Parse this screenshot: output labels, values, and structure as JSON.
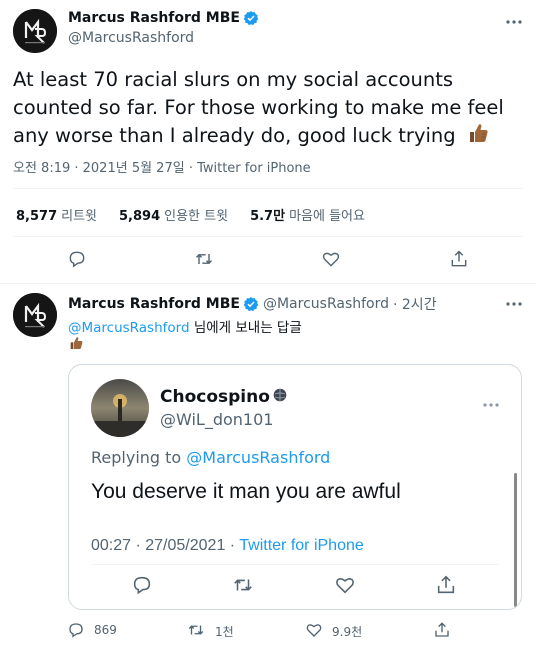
{
  "main_tweet": {
    "author": {
      "display_name": "Marcus Rashford MBE",
      "handle": "@MarcusRashford",
      "verified": true
    },
    "text": "At least 70 racial slurs on my social accounts counted so far. For those working to make me feel any worse than I already do, good luck trying",
    "emoji": "thumbs-up (medium-dark skin tone)",
    "timestamp": "오전 8:19 · 2021년 5월 27일 · Twitter for iPhone",
    "stats": {
      "retweets_value": "8,577",
      "retweets_label": "리트윗",
      "quotes_value": "5,894",
      "quotes_label": "인용한 트윗",
      "likes_value": "5.7만",
      "likes_label": "마음에 들어요"
    }
  },
  "reply_tweet": {
    "author": {
      "display_name": "Marcus Rashford MBE",
      "handle": "@MarcusRashford",
      "time": "· 2시간",
      "verified": true
    },
    "reply_to_mention": "@MarcusRashford",
    "reply_to_suffix": " 님에게 보내는 답글",
    "emoji": "thumbs-up (medium-dark skin tone)",
    "quoted_screenshot": {
      "display_name": "Chocospino",
      "handle": "@WiL_don101",
      "replying_prefix": "Replying to ",
      "replying_mention": "@MarcusRashford",
      "text": "You deserve it man you are awful",
      "time": "00:27 · 27/05/2021 · ",
      "source": "Twitter for iPhone"
    },
    "stats": {
      "replies": "869",
      "retweets": "1천",
      "likes": "9.9천"
    }
  },
  "colors": {
    "accent": "#1d9bf0",
    "text_primary": "#0f1419",
    "text_secondary": "#536471",
    "divider": "#eff3f4",
    "emoji_skin": "#a0673c"
  }
}
